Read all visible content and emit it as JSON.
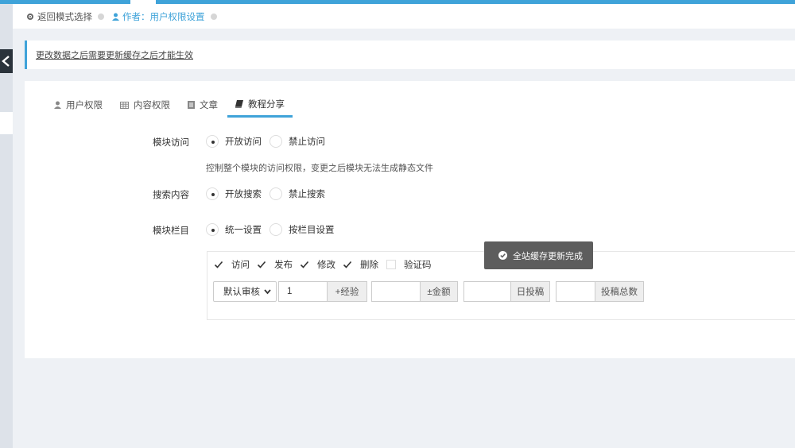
{
  "breadcrumb": {
    "back": "返回模式选择",
    "current": "作者：用户权限设置"
  },
  "notice": "更改数据之后需要更新缓存之后才能生效",
  "tabs": [
    {
      "label": "用户权限",
      "icon": "user-icon"
    },
    {
      "label": "内容权限",
      "icon": "table-icon"
    },
    {
      "label": "文章",
      "icon": "document-icon"
    },
    {
      "label": "教程分享",
      "icon": "book-icon",
      "active": true
    }
  ],
  "form": {
    "module_access": {
      "label": "模块访问",
      "options": [
        "开放访问",
        "禁止访问"
      ],
      "selected": "开放访问",
      "help": "控制整个模块的访问权限，变更之后模块无法生成静态文件"
    },
    "search_content": {
      "label": "搜索内容",
      "options": [
        "开放搜索",
        "禁止搜索"
      ],
      "selected": "开放搜索"
    },
    "module_column": {
      "label": "模块栏目",
      "options": [
        "统一设置",
        "按栏目设置"
      ],
      "selected": "统一设置"
    }
  },
  "permissions": [
    {
      "label": "访问",
      "checked": true
    },
    {
      "label": "发布",
      "checked": true
    },
    {
      "label": "修改",
      "checked": true
    },
    {
      "label": "删除",
      "checked": true
    },
    {
      "label": "验证码",
      "checked": false
    }
  ],
  "review_select": "默认审核",
  "inputs": [
    {
      "value": "1",
      "addon": "+经验"
    },
    {
      "value": "",
      "addon": "±金额"
    },
    {
      "value": "",
      "addon": "日投稿"
    },
    {
      "value": "",
      "addon": "投稿总数"
    }
  ],
  "toast": "全站缓存更新完成",
  "colors": {
    "accent": "#3fa3d9",
    "toast_bg": "#5d5d5d"
  }
}
